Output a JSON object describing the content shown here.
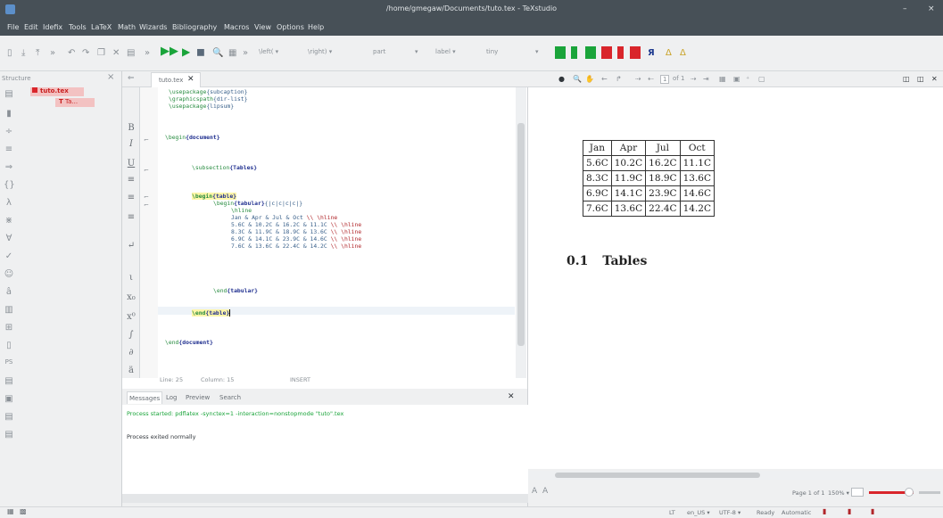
{
  "window": {
    "title": "/home/gmegaw/Documents/tuto.tex - TeXstudio",
    "minimize": "–",
    "close": "×"
  },
  "menu": [
    "File",
    "Edit",
    "Idefix",
    "Tools",
    "LaTeX",
    "Math",
    "Wizards",
    "Bibliography",
    "Macros",
    "View",
    "Options",
    "Help"
  ],
  "toolbar": {
    "left_sel": "\\left(",
    "right_sel": "\\right)",
    "part": "part",
    "label": "label",
    "size": "tiny",
    "dropdown_arrow": "▾"
  },
  "structure": {
    "header": "Structure",
    "close": "×",
    "file": "tuto.tex",
    "child": "Ta...",
    "child_icon": "T"
  },
  "editor": {
    "tab_label": "tuto.tex",
    "tab_close": "✕",
    "status": {
      "line": "Line: 25",
      "column": "Column: 15",
      "mode": "INSERT"
    },
    "code": {
      "l1_cmd": "\\usepackage",
      "l1_arg": "{subcaption}",
      "l2_cmd": "\\graphicspath",
      "l2_arg": "{dir-list}",
      "l3_cmd": "\\usepackage",
      "l3_arg": "{lipsum}",
      "l4_cmd": "\\begin",
      "l4_arg": "{document}",
      "l5_cmd": "\\subsection",
      "l5_arg": "{Tables}",
      "l6_cmd": "\\begin",
      "l6_arg": "{table}",
      "l7_cmd": "\\begin",
      "l7_arg": "{tabular}",
      "l7_rest": "{|c|c|c|c|}",
      "l8": "\\hline",
      "l9": "Jan & Apr & Jul & Oct ",
      "l9_nl": "\\\\ \\hline",
      "l10": "5.6C & 10.2C & 16.2C & 11.1C ",
      "l10_nl": "\\\\ \\hline",
      "l11": "8.3C & 11.9C & 18.9C & 13.6C ",
      "l11_nl": "\\\\ \\hline",
      "l12": "6.9C & 14.1C & 23.9C & 14.6C ",
      "l12_nl": "\\\\ \\hline",
      "l13": "7.6C & 13.6C & 22.4C & 14.2C ",
      "l13_nl": "\\\\ \\hline",
      "l14_cmd": "\\end",
      "l14_arg": "{tabular}",
      "l15_cmd": "\\end",
      "l15_arg": "{table}",
      "l16_cmd": "\\end",
      "l16_arg": "{document}"
    },
    "symbols": [
      "B",
      "I",
      "U",
      "≡",
      "≡",
      "≡",
      "↵",
      "ι",
      "x₀",
      "x⁰",
      "∫",
      "∂",
      "ä"
    ]
  },
  "messages": {
    "tabs": [
      "Messages",
      "Log",
      "Preview",
      "Search Results"
    ],
    "close": "✕",
    "line1": "Process started: pdflatex -synctex=1 -interaction=nonstopmode \"tuto\".tex",
    "line2": "Process exited normally"
  },
  "preview": {
    "page_input": "1",
    "page_of": "of 1",
    "table": [
      [
        "Jan",
        "Apr",
        "Jul",
        "Oct"
      ],
      [
        "5.6C",
        "10.2C",
        "16.2C",
        "11.1C"
      ],
      [
        "8.3C",
        "11.9C",
        "18.9C",
        "13.6C"
      ],
      [
        "6.9C",
        "14.1C",
        "23.9C",
        "14.6C"
      ],
      [
        "7.6C",
        "13.6C",
        "22.4C",
        "14.2C"
      ]
    ],
    "section_num": "0.1",
    "section_title": "Tables",
    "page_info": "Page 1 of 1",
    "zoom": "150% ▾"
  },
  "statusbar": {
    "lang": "en_US ▾",
    "encoding": "UTF-8 ▾",
    "state": "Ready",
    "mode": "Automatic"
  },
  "colors": {
    "accent_red": "#d9252b",
    "green": "#1aa43a",
    "blue": "#1e3a8f",
    "title_bg": "#475057"
  }
}
